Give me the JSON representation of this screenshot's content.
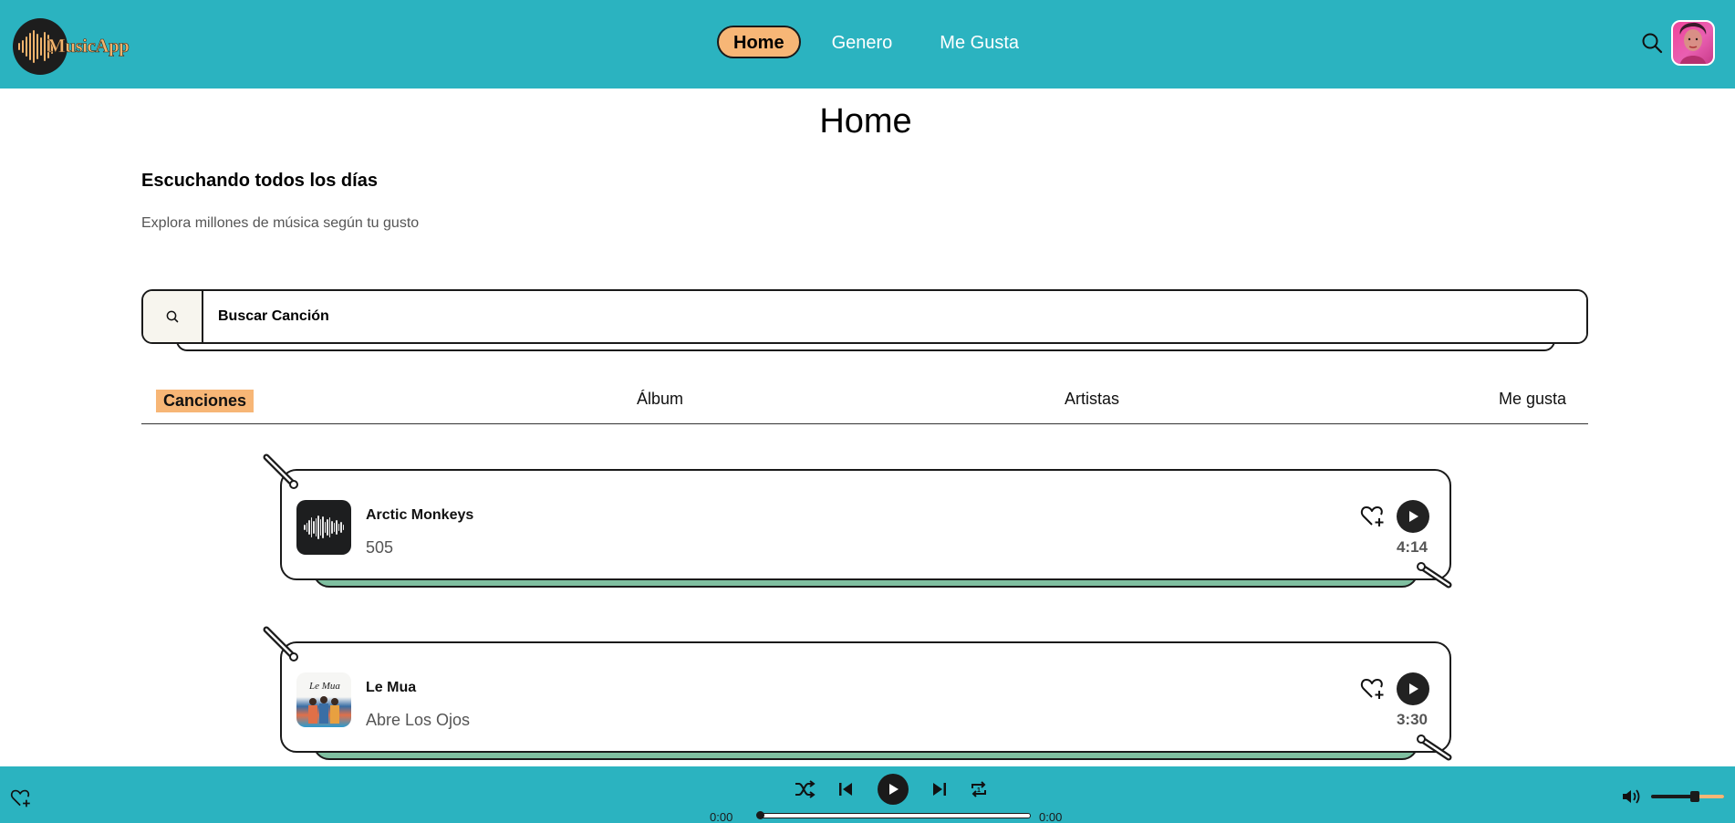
{
  "app": {
    "logo_text": "MusicApp"
  },
  "header": {
    "nav": [
      {
        "label": "Home",
        "active": true
      },
      {
        "label": "Genero",
        "active": false
      },
      {
        "label": "Me Gusta",
        "active": false
      }
    ],
    "search_icon": "search-icon",
    "avatar_icon": "user-avatar"
  },
  "main": {
    "title": "Home",
    "section_title": "Escuchando todos los días",
    "section_subtitle": "Explora millones de música según tu gusto",
    "search": {
      "placeholder": "Buscar Canción",
      "value": ""
    },
    "tabs": [
      {
        "label": "Canciones",
        "active": true
      },
      {
        "label": "Álbum",
        "active": false
      },
      {
        "label": "Artistas",
        "active": false
      },
      {
        "label": "Me gusta",
        "active": false
      }
    ],
    "songs": [
      {
        "artist": "Arctic Monkeys",
        "title": "505",
        "duration": "4:14",
        "cover": "arctic-monkeys-cover"
      },
      {
        "artist": "Le Mua",
        "title": "Abre Los Ojos",
        "duration": "3:30",
        "cover": "le-mua-cover"
      }
    ]
  },
  "player": {
    "current_time": "0:00",
    "total_time": "0:00",
    "progress": 0,
    "volume": 0.6,
    "colors": {
      "bar": "#2bb3c0",
      "accent": "#f7b676",
      "dark": "#1a1a1a"
    }
  }
}
